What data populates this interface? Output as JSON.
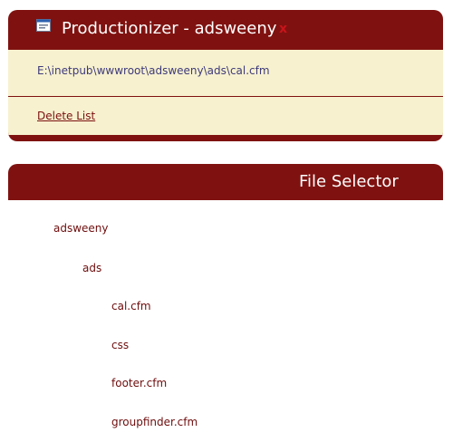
{
  "app": {
    "title": "Productionizer - adsweeny",
    "close_glyph": "x"
  },
  "path": {
    "text": "E:\\inetpub\\wwwroot\\adsweeny\\ads\\cal.cfm"
  },
  "actions": {
    "delete_list": "Delete List"
  },
  "file_selector": {
    "title": "File Selector",
    "tree": [
      {
        "label": "adsweeny"
      },
      {
        "label": "ads"
      },
      {
        "label": "cal.cfm"
      },
      {
        "label": "css"
      },
      {
        "label": "footer.cfm"
      },
      {
        "label": "groupfinder.cfm"
      }
    ]
  },
  "colors": {
    "accent": "#7f1210",
    "panel_bg": "#f7f1cf",
    "path_text": "#3e3a7a",
    "tree_text": "#6e0d0d"
  }
}
